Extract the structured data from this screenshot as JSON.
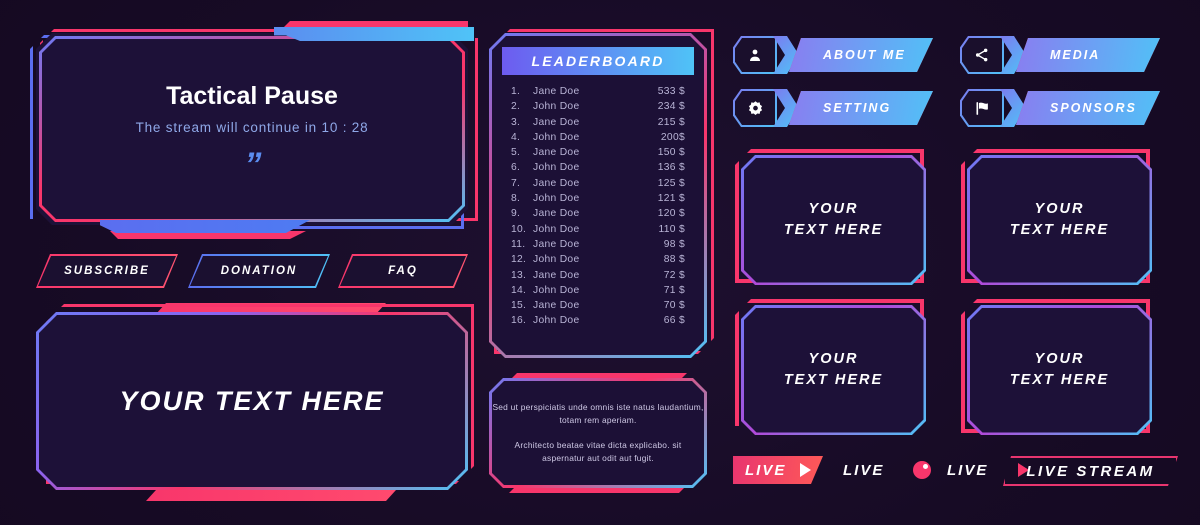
{
  "theme": {
    "background": "#140820",
    "panel_fill": "#1d1138",
    "pink": "#f8366b",
    "blue": "#5b6ef0",
    "cyan": "#4fc3f7",
    "purple": "#6d5bf0",
    "text_muted": "#b9b4d6"
  },
  "tactical_pause": {
    "title": "Tactical Pause",
    "subtitle": "The stream will continue in 10 : 28",
    "quote_glyph": "”"
  },
  "pill_buttons": [
    {
      "label": "SUBSCRIBE",
      "accent": "pink"
    },
    {
      "label": "DONATION",
      "accent": "blue"
    },
    {
      "label": "FAQ",
      "accent": "pink"
    }
  ],
  "big_text_panel": {
    "label": "YOUR TEXT HERE"
  },
  "leaderboard": {
    "header": "LEADERBOARD",
    "rows": [
      {
        "rank": "1.",
        "name": "Jane Doe",
        "amount": "533 $"
      },
      {
        "rank": "2.",
        "name": "John Doe",
        "amount": "234 $"
      },
      {
        "rank": "3.",
        "name": "Jane Doe",
        "amount": "215 $"
      },
      {
        "rank": "4.",
        "name": "John Doe",
        "amount": "200$"
      },
      {
        "rank": "5.",
        "name": "Jane Doe",
        "amount": "150 $"
      },
      {
        "rank": "6.",
        "name": "John Doe",
        "amount": "136 $"
      },
      {
        "rank": "7.",
        "name": "Jane Doe",
        "amount": "125 $"
      },
      {
        "rank": "8.",
        "name": "John Doe",
        "amount": "121 $"
      },
      {
        "rank": "9.",
        "name": "Jane Doe",
        "amount": "120 $"
      },
      {
        "rank": "10.",
        "name": "John Doe",
        "amount": "110 $"
      },
      {
        "rank": "11.",
        "name": "Jane Doe",
        "amount": "98 $"
      },
      {
        "rank": "12.",
        "name": "John Doe",
        "amount": "88 $"
      },
      {
        "rank": "13.",
        "name": "Jane Doe",
        "amount": "72 $"
      },
      {
        "rank": "14.",
        "name": "John Doe",
        "amount": "71 $"
      },
      {
        "rank": "15.",
        "name": "Jane Doe",
        "amount": "70 $"
      },
      {
        "rank": "16.",
        "name": "John Doe",
        "amount": "66 $"
      }
    ]
  },
  "lorem_panel": {
    "paragraph_1": "Sed ut perspiciatis unde omnis iste natus laudantium, totam rem aperiam.",
    "paragraph_2": "Architecto beatae vitae dicta   explicabo. sit aspernatur aut odit aut fugit."
  },
  "nav_buttons": [
    {
      "label": "ABOUT ME",
      "icon": "person-icon"
    },
    {
      "label": "MEDIA",
      "icon": "share-icon"
    },
    {
      "label": "SETTING",
      "icon": "gear-icon"
    },
    {
      "label": "SPONSORS",
      "icon": "flag-icon"
    }
  ],
  "frames": [
    {
      "line1": "YOUR",
      "line2": "TEXT HERE"
    },
    {
      "line1": "YOUR",
      "line2": "TEXT HERE"
    },
    {
      "line1": "YOUR",
      "line2": "TEXT HERE"
    },
    {
      "line1": "YOUR",
      "line2": "TEXT HERE"
    }
  ],
  "live_badges": [
    {
      "label": "LIVE",
      "indicator": "play-triangle-icon",
      "style": "filled"
    },
    {
      "label": "LIVE",
      "indicator": "record-dot-icon",
      "style": "plain"
    },
    {
      "label": "LIVE",
      "indicator": "play-triangle-icon",
      "style": "plain"
    },
    {
      "label": "LIVE STREAM",
      "indicator": "none",
      "style": "outline"
    }
  ]
}
